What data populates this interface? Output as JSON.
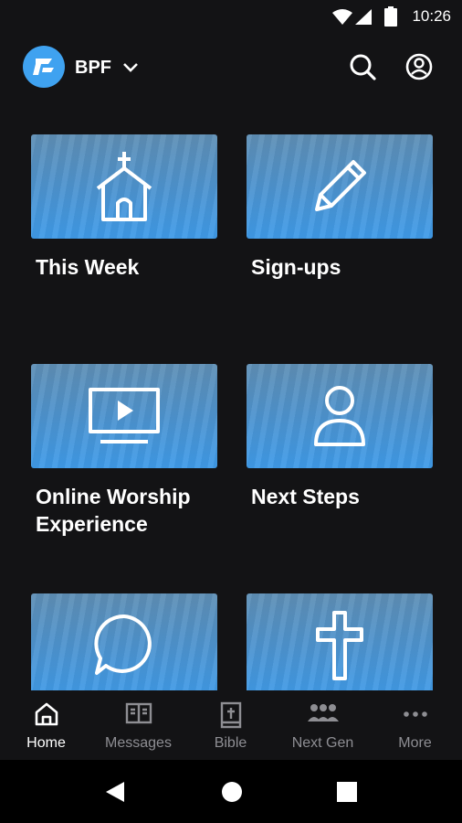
{
  "status_bar": {
    "time": "10:26"
  },
  "header": {
    "org_name": "BPF"
  },
  "tiles": [
    {
      "title": "This Week",
      "icon": "church-icon"
    },
    {
      "title": "Sign-ups",
      "icon": "pencil-icon"
    },
    {
      "title": "Online Worship Experience",
      "icon": "video-screen-icon"
    },
    {
      "title": "Next Steps",
      "icon": "person-icon"
    },
    {
      "title": "",
      "icon": "chat-bubble-icon"
    },
    {
      "title": "",
      "icon": "cross-icon"
    }
  ],
  "bottom_nav": [
    {
      "label": "Home",
      "icon": "home-icon",
      "active": true
    },
    {
      "label": "Messages",
      "icon": "book-open-icon",
      "active": false
    },
    {
      "label": "Bible",
      "icon": "bible-icon",
      "active": false
    },
    {
      "label": "Next Gen",
      "icon": "group-icon",
      "active": false
    },
    {
      "label": "More",
      "icon": "more-dots-icon",
      "active": false
    }
  ],
  "colors": {
    "background": "#131315",
    "accent": "#3fa2f0",
    "tile_gradient_bottom": "#3f9be9",
    "nav_inactive": "#8e8e93"
  }
}
